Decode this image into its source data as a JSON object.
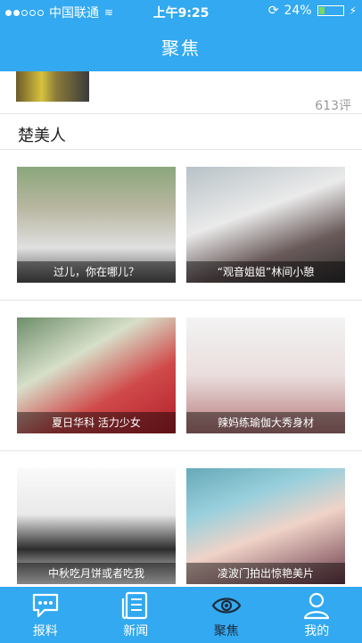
{
  "status": {
    "carrier": "中国联通",
    "time": "上午9:25",
    "battery": "24%"
  },
  "header": {
    "title": "聚焦"
  },
  "previous": {
    "comments": "613评"
  },
  "section": {
    "title": "楚美人"
  },
  "grid": [
    {
      "caption": "过儿，你在哪儿？"
    },
    {
      "caption": "“观音姐姐”林间小憩"
    },
    {
      "caption": "夏日华科 活力少女"
    },
    {
      "caption": "辣妈练瑜伽大秀身材"
    },
    {
      "caption": "中秋吃月饼或者吃我"
    },
    {
      "caption": "凌波门拍出惊艳美片"
    }
  ],
  "tabs": [
    {
      "label": "报料",
      "icon": "chat-bubble-icon"
    },
    {
      "label": "新闻",
      "icon": "news-list-icon"
    },
    {
      "label": "聚焦",
      "icon": "eye-icon",
      "active": true
    },
    {
      "label": "我的",
      "icon": "user-icon"
    }
  ],
  "colors": {
    "primary": "#32a9f0",
    "active_tab_text": "#1f2a3a"
  }
}
